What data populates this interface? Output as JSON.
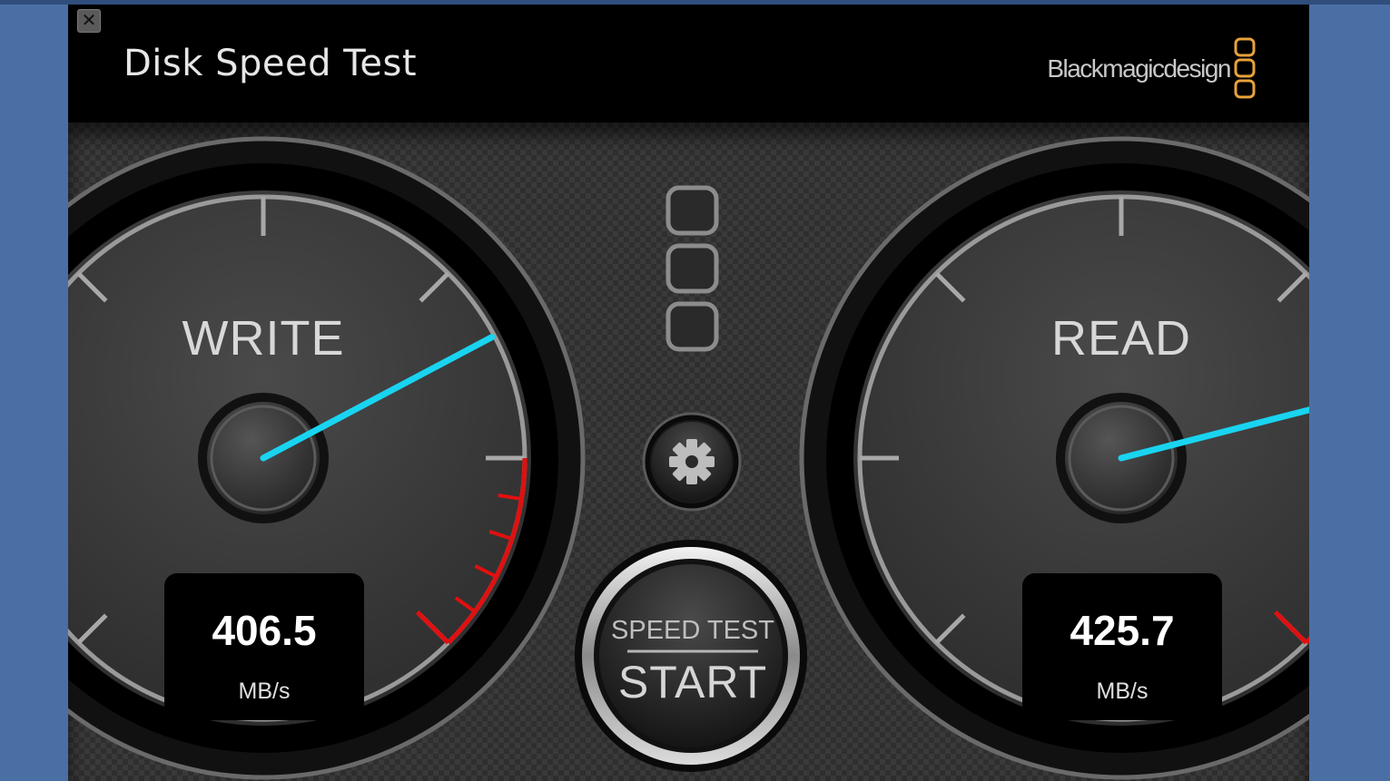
{
  "window": {
    "close_glyph": "✕",
    "title": "Disk Speed Test",
    "brand": "Blackmagicdesign"
  },
  "write_gauge": {
    "label": "WRITE",
    "value": "406.5",
    "unit": "MB/s",
    "needle_fraction": 0.73
  },
  "read_gauge": {
    "label": "READ",
    "value": "425.7",
    "unit": "MB/s",
    "needle_fraction": 0.78
  },
  "settings": {
    "icon": "gear-icon"
  },
  "start_button": {
    "caption": "SPEED TEST",
    "label": "START"
  },
  "colors": {
    "accent_needle": "#19d4f0",
    "redline": "#e01010",
    "logo_orange": "#e8a23a",
    "desktop_blue": "#4a6fa5"
  }
}
